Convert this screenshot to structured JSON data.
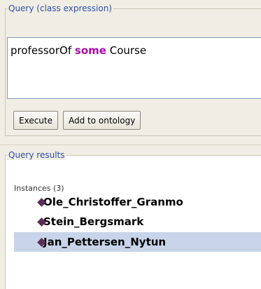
{
  "query_panel": {
    "title": "Query (class expression)",
    "expression": {
      "property": "professorOf",
      "keyword": "some",
      "class": "Course"
    },
    "execute_label": "Execute",
    "add_to_ontology_label": "Add to ontology"
  },
  "results_panel": {
    "title": "Query results",
    "instances_header": "Instances (3)",
    "items": [
      {
        "label": "Ole_Christoffer_Granmo",
        "selected": false,
        "icon": "individual-diamond-icon"
      },
      {
        "label": "Stein_Bergsmark",
        "selected": false,
        "icon": "individual-diamond-icon"
      },
      {
        "label": "Jan_Pettersen_Nytun",
        "selected": true,
        "icon": "individual-diamond-icon"
      }
    ]
  },
  "colors": {
    "keyword": "#a20fa6",
    "legend_text": "#2f4fa6",
    "selection": "#c7d4e9",
    "individual_icon": "#5b2d55"
  }
}
